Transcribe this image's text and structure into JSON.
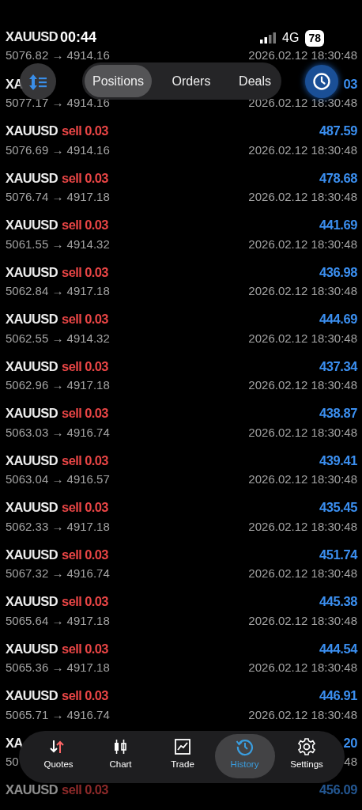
{
  "status_bar": {
    "time": "00:44",
    "network": "4G",
    "battery": "78"
  },
  "segments": [
    {
      "label": "Positions",
      "selected": true
    },
    {
      "label": "Orders",
      "selected": false
    },
    {
      "label": "Deals",
      "selected": false
    }
  ],
  "rows": [
    {
      "symbol": "XAUUSD",
      "prices": "5076.82 → 4914.16",
      "time": "2026.02.12 18:30:48",
      "faded": false
    },
    {
      "symbol": "XA",
      "profit": "03",
      "prices": "5077.17 → 4914.16",
      "time": "2026.02.12 18:30:48",
      "faded": false
    },
    {
      "symbol": "XAUUSD",
      "trade": "sell 0.03",
      "profit": "487.59",
      "prices": "5076.69 → 4914.16",
      "time": "2026.02.12 18:30:48",
      "faded": false
    },
    {
      "symbol": "XAUUSD",
      "trade": "sell 0.03",
      "profit": "478.68",
      "prices": "5076.74 → 4917.18",
      "time": "2026.02.12 18:30:48",
      "faded": false
    },
    {
      "symbol": "XAUUSD",
      "trade": "sell 0.03",
      "profit": "441.69",
      "prices": "5061.55 → 4914.32",
      "time": "2026.02.12 18:30:48",
      "faded": false
    },
    {
      "symbol": "XAUUSD",
      "trade": "sell 0.03",
      "profit": "436.98",
      "prices": "5062.84 → 4917.18",
      "time": "2026.02.12 18:30:48",
      "faded": false
    },
    {
      "symbol": "XAUUSD",
      "trade": "sell 0.03",
      "profit": "444.69",
      "prices": "5062.55 → 4914.32",
      "time": "2026.02.12 18:30:48",
      "faded": false
    },
    {
      "symbol": "XAUUSD",
      "trade": "sell 0.03",
      "profit": "437.34",
      "prices": "5062.96 → 4917.18",
      "time": "2026.02.12 18:30:48",
      "faded": false
    },
    {
      "symbol": "XAUUSD",
      "trade": "sell 0.03",
      "profit": "438.87",
      "prices": "5063.03 → 4916.74",
      "time": "2026.02.12 18:30:48",
      "faded": false
    },
    {
      "symbol": "XAUUSD",
      "trade": "sell 0.03",
      "profit": "439.41",
      "prices": "5063.04 → 4916.57",
      "time": "2026.02.12 18:30:48",
      "faded": false
    },
    {
      "symbol": "XAUUSD",
      "trade": "sell 0.03",
      "profit": "435.45",
      "prices": "5062.33 → 4917.18",
      "time": "2026.02.12 18:30:48",
      "faded": false
    },
    {
      "symbol": "XAUUSD",
      "trade": "sell 0.03",
      "profit": "451.74",
      "prices": "5067.32 → 4916.74",
      "time": "2026.02.12 18:30:48",
      "faded": false
    },
    {
      "symbol": "XAUUSD",
      "trade": "sell 0.03",
      "profit": "445.38",
      "prices": "5065.64 → 4917.18",
      "time": "2026.02.12 18:30:48",
      "faded": false
    },
    {
      "symbol": "XAUUSD",
      "trade": "sell 0.03",
      "profit": "444.54",
      "prices": "5065.36 → 4917.18",
      "time": "2026.02.12 18:30:48",
      "faded": false
    },
    {
      "symbol": "XAUUSD",
      "trade": "sell 0.03",
      "profit": "446.91",
      "prices": "5065.71 → 4916.74",
      "time": "2026.02.12 18:30:48",
      "faded": false
    },
    {
      "symbol": "XA",
      "profit": "20",
      "prices": "50",
      "time": "48",
      "faded": false
    },
    {
      "symbol": "XAUUSD",
      "trade": "sell 0.03",
      "profit": "456.09",
      "faded": true
    }
  ],
  "nav": [
    {
      "label": "Quotes",
      "selected": false
    },
    {
      "label": "Chart",
      "selected": false
    },
    {
      "label": "Trade",
      "selected": false
    },
    {
      "label": "History",
      "selected": true
    },
    {
      "label": "Settings",
      "selected": false
    }
  ]
}
